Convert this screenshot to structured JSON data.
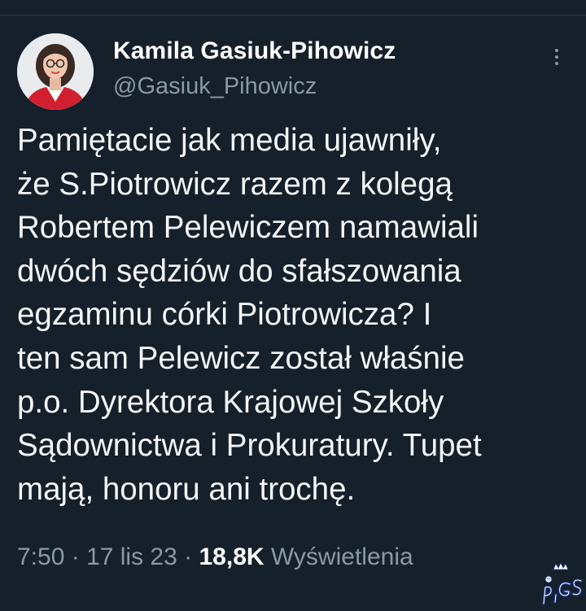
{
  "tweet": {
    "author_name": "Kamila Gasiuk-Pihowicz",
    "author_handle": "@Gasiuk_Pihowicz",
    "text_lines": [
      "Pamiętacie jak media ujawniły,",
      "że S.Piotrowicz razem z kolegą",
      "Robertem Pelewiczem namawiali",
      "dwóch sędziów do sfałszowania",
      "egzaminu córki Piotrowicza? I",
      "ten sam Pelewicz został właśnie",
      "p.o. Dyrektora Krajowej Szkoły",
      "Sądownictwa i Prokuratury. Tupet",
      "mają, honoru ani trochę."
    ],
    "time": "7:50",
    "separator": " · ",
    "date": "17 lis 23",
    "views_count": "18,8K",
    "views_label": " Wyświetlenia"
  },
  "icons": {
    "more": "more-vertical-icon",
    "watermark": "pigs-logo"
  },
  "colors": {
    "background": "#15202b",
    "text": "#f3f5f7",
    "secondary_text": "#8b98a5",
    "avatar_jacket": "#d21f2f"
  }
}
